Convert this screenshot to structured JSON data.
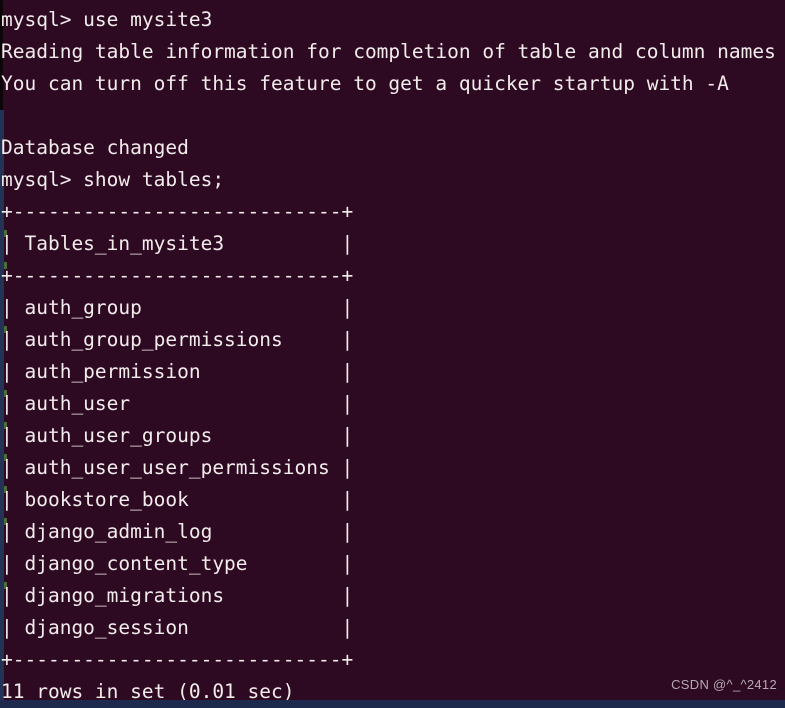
{
  "terminal": {
    "background_color": "#2d0a22",
    "text_color": "#f2eceb",
    "prompt": "mysql>",
    "lines": [
      "mysql> use mysite3",
      "Reading table information for completion of table and column names",
      "You can turn off this feature to get a quicker startup with -A",
      "",
      "Database changed",
      "mysql> show tables;",
      "+----------------------------+",
      "| Tables_in_mysite3          |",
      "+----------------------------+",
      "| auth_group                 |",
      "| auth_group_permissions     |",
      "| auth_permission            |",
      "| auth_user                  |",
      "| auth_user_groups           |",
      "| auth_user_user_permissions |",
      "| bookstore_book             |",
      "| django_admin_log           |",
      "| django_content_type        |",
      "| django_migrations          |",
      "| django_session             |",
      "+----------------------------+",
      "11 rows in set (0.01 sec)"
    ]
  },
  "commands": {
    "use_database": "use mysite3",
    "show_tables": "show tables;"
  },
  "messages": {
    "reading_table_info": "Reading table information for completion of table and column names",
    "turn_off_feature": "You can turn off this feature to get a quicker startup with -A",
    "database_changed": "Database changed",
    "rows_in_set": "11 rows in set (0.01 sec)"
  },
  "result_table": {
    "column_header": "Tables_in_mysite3",
    "row_count": 11,
    "elapsed_seconds": "0.01",
    "rows": [
      "auth_group",
      "auth_group_permissions",
      "auth_permission",
      "auth_user",
      "auth_user_groups",
      "auth_user_user_permissions",
      "bookstore_book",
      "django_admin_log",
      "django_content_type",
      "django_migrations",
      "django_session"
    ]
  },
  "watermark": {
    "text": "CSDN @^_^2412"
  }
}
